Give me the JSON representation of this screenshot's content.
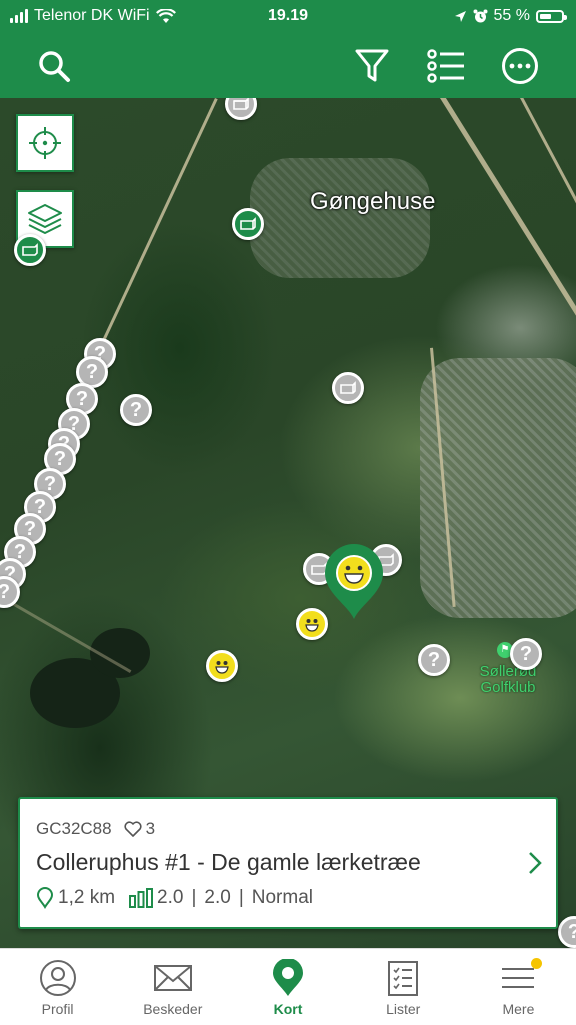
{
  "status_bar": {
    "carrier": "Telenor DK WiFi",
    "time": "19.19",
    "battery_text": "55 %",
    "battery_level": 0.55
  },
  "toolbar": {
    "icons": [
      "search-icon",
      "filter-icon",
      "list-icon",
      "more-icon"
    ]
  },
  "map": {
    "place_name": "Gøngehuse",
    "golf_club_label": "Søllerød Golfklub",
    "controls": [
      "crosshair-icon",
      "layers-icon"
    ]
  },
  "cache_card": {
    "code": "GC32C88",
    "favorites": "3",
    "title": "Colleruphus #1 - De gamle lærketræe",
    "distance": "1,2 km",
    "difficulty": "2.0",
    "terrain": "2.0",
    "size": "Normal",
    "separator": "|"
  },
  "tab_bar": {
    "tabs": [
      {
        "label": "Profil",
        "icon": "profile-icon"
      },
      {
        "label": "Beskeder",
        "icon": "envelope-icon"
      },
      {
        "label": "Kort",
        "icon": "map-pin-icon",
        "active": true
      },
      {
        "label": "Lister",
        "icon": "checklist-icon"
      },
      {
        "label": "Mere",
        "icon": "menu-icon"
      }
    ]
  },
  "colors": {
    "brand_green": "#1e8c4a",
    "smiley_yellow": "#f2de1d",
    "marker_gray": "#b5b5b5"
  }
}
